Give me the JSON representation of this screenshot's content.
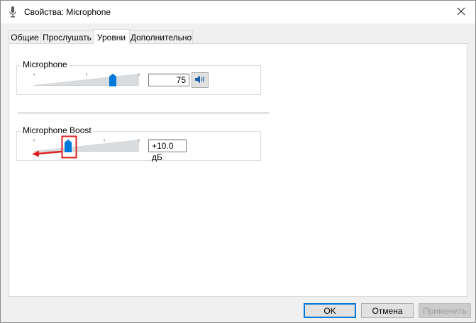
{
  "window": {
    "title": "Свойства: Microphone"
  },
  "tabs": [
    {
      "label": "Общие"
    },
    {
      "label": "Прослушать"
    },
    {
      "label": "Уровни",
      "active": true
    },
    {
      "label": "Дополнительно"
    }
  ],
  "levels": {
    "microphone": {
      "label": "Microphone",
      "value": "75",
      "level_percent": 75
    },
    "boost": {
      "label": "Microphone Boost",
      "value": "+10.0 дБ",
      "level_fraction": 0.33
    }
  },
  "buttons": {
    "ok": "OK",
    "cancel": "Отмена",
    "apply": "Применить"
  },
  "colors": {
    "accent": "#0078d7",
    "annotation": "#e02020"
  },
  "icons": {
    "title": "microphone-icon",
    "mute": "speaker-icon",
    "close": "close-icon"
  }
}
